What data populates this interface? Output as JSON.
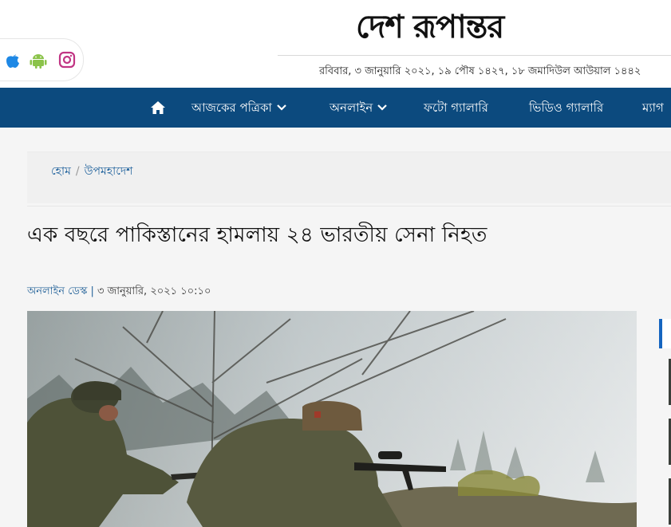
{
  "site": {
    "logo_text": "দেশ রূপান্তর",
    "date_text": "রবিবার, ৩ জানুয়ারি ২০২১, ১৯ পৌষ ১৪২৭, ১৮ জমাদিউল আউয়াল ১৪৪২"
  },
  "social": [
    {
      "icon": "apple-icon",
      "color": "#1e88e5"
    },
    {
      "icon": "android-icon",
      "color": "#8bc34a"
    },
    {
      "icon": "instagram-icon",
      "color": "#c13584"
    }
  ],
  "nav": {
    "home_icon": "home-icon",
    "items": [
      {
        "label": "আজকের পত্রিকা",
        "dropdown": true
      },
      {
        "label": "অনলাইন",
        "dropdown": true
      },
      {
        "label": "ফটো গ্যালারি",
        "dropdown": false
      },
      {
        "label": "ভিডিও গ্যালারি",
        "dropdown": false
      },
      {
        "label": "ম্যাগ",
        "dropdown": false
      }
    ],
    "bg_color": "#0c4a7e"
  },
  "breadcrumb": {
    "home": "হোম",
    "separator": "/",
    "section": "উপমহাদেশ"
  },
  "article": {
    "headline": "এক বছরে পাকিস্তানের হামলায় ২৪ ভারতীয় সেনা নিহত",
    "author": "অনলাইন ডেস্ক",
    "separator": "|",
    "published": "৩ জানুয়ারি, ২০২১ ১০:১০"
  }
}
